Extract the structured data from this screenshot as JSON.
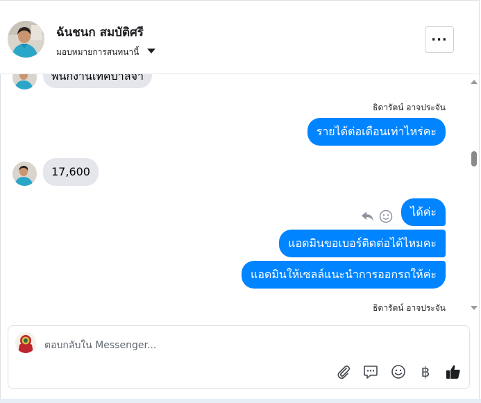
{
  "header": {
    "name": "ฉันชนก สมบัติศรี",
    "subtitle": "มอบหมายการสนทนานี้",
    "more_label": "···"
  },
  "messages": {
    "partial_top_text": "พนักงานเทคบาลจ้า",
    "sender_1": "ธิดารัตน์ อาจประจัน",
    "out_1": "รายได้ต่อเดือนเท่าไหร่คะ",
    "in_1": "17,600",
    "out_2": "ได้ค่ะ",
    "out_3": "แอดมินขอเบอร์ติดต่อได้ไหมคะ",
    "out_4": "แอดมินให้เซลล์แนะนำการออกรถให้ค่ะ",
    "sender_2": "ธิดารัตน์ อาจประจัน"
  },
  "composer": {
    "placeholder": "ตอบกลับใน Messenger...",
    "value": "",
    "tools": [
      "paperclip-icon",
      "speech-bubble-icon",
      "emoji-icon",
      "baht-icon",
      "thumbs-up-icon"
    ],
    "baht_symbol": "฿"
  },
  "colors": {
    "outgoing_bubble": "#0084ff",
    "incoming_bubble": "#e4e6eb"
  }
}
